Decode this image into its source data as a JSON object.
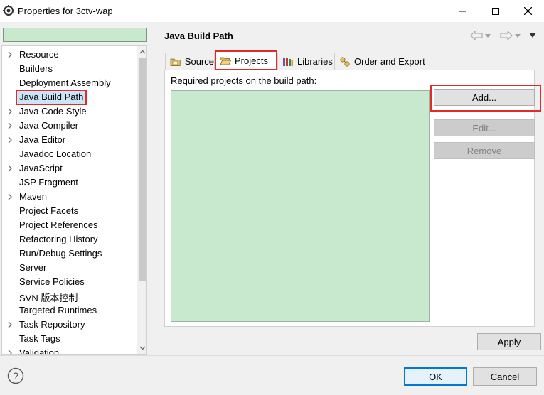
{
  "window": {
    "title": "Properties for 3ctv-wap",
    "icon": "gear-icon"
  },
  "sidebar": {
    "filter_value": "",
    "items": [
      {
        "label": "Resource",
        "expandable": true
      },
      {
        "label": "Builders",
        "expandable": false
      },
      {
        "label": "Deployment Assembly",
        "expandable": false
      },
      {
        "label": "Java Build Path",
        "expandable": false,
        "selected": true
      },
      {
        "label": "Java Code Style",
        "expandable": true
      },
      {
        "label": "Java Compiler",
        "expandable": true
      },
      {
        "label": "Java Editor",
        "expandable": true
      },
      {
        "label": "Javadoc Location",
        "expandable": false
      },
      {
        "label": "JavaScript",
        "expandable": true
      },
      {
        "label": "JSP Fragment",
        "expandable": false
      },
      {
        "label": "Maven",
        "expandable": true
      },
      {
        "label": "Project Facets",
        "expandable": false
      },
      {
        "label": "Project References",
        "expandable": false
      },
      {
        "label": "Refactoring History",
        "expandable": false
      },
      {
        "label": "Run/Debug Settings",
        "expandable": false
      },
      {
        "label": "Server",
        "expandable": false
      },
      {
        "label": "Service Policies",
        "expandable": false
      },
      {
        "label": "SVN 版本控制",
        "expandable": false
      },
      {
        "label": "Targeted Runtimes",
        "expandable": false
      },
      {
        "label": "Task Repository",
        "expandable": true
      },
      {
        "label": "Task Tags",
        "expandable": false
      },
      {
        "label": "Validation",
        "expandable": true
      }
    ]
  },
  "main": {
    "title": "Java Build Path",
    "tabs": [
      {
        "label": "Source",
        "icon": "source-folder-icon"
      },
      {
        "label": "Projects",
        "icon": "open-folder-icon",
        "active": true
      },
      {
        "label": "Libraries",
        "icon": "libraries-icon"
      },
      {
        "label": "Order and Export",
        "icon": "order-export-icon"
      }
    ],
    "required_label": "Required projects on the build path:",
    "buttons": {
      "add": "Add...",
      "edit": "Edit...",
      "remove": "Remove"
    },
    "apply": "Apply"
  },
  "footer": {
    "ok": "OK",
    "cancel": "Cancel"
  },
  "colors": {
    "highlight_red": "#e02b2b",
    "list_bg": "#c9e9ce",
    "ok_border": "#0078d7"
  }
}
